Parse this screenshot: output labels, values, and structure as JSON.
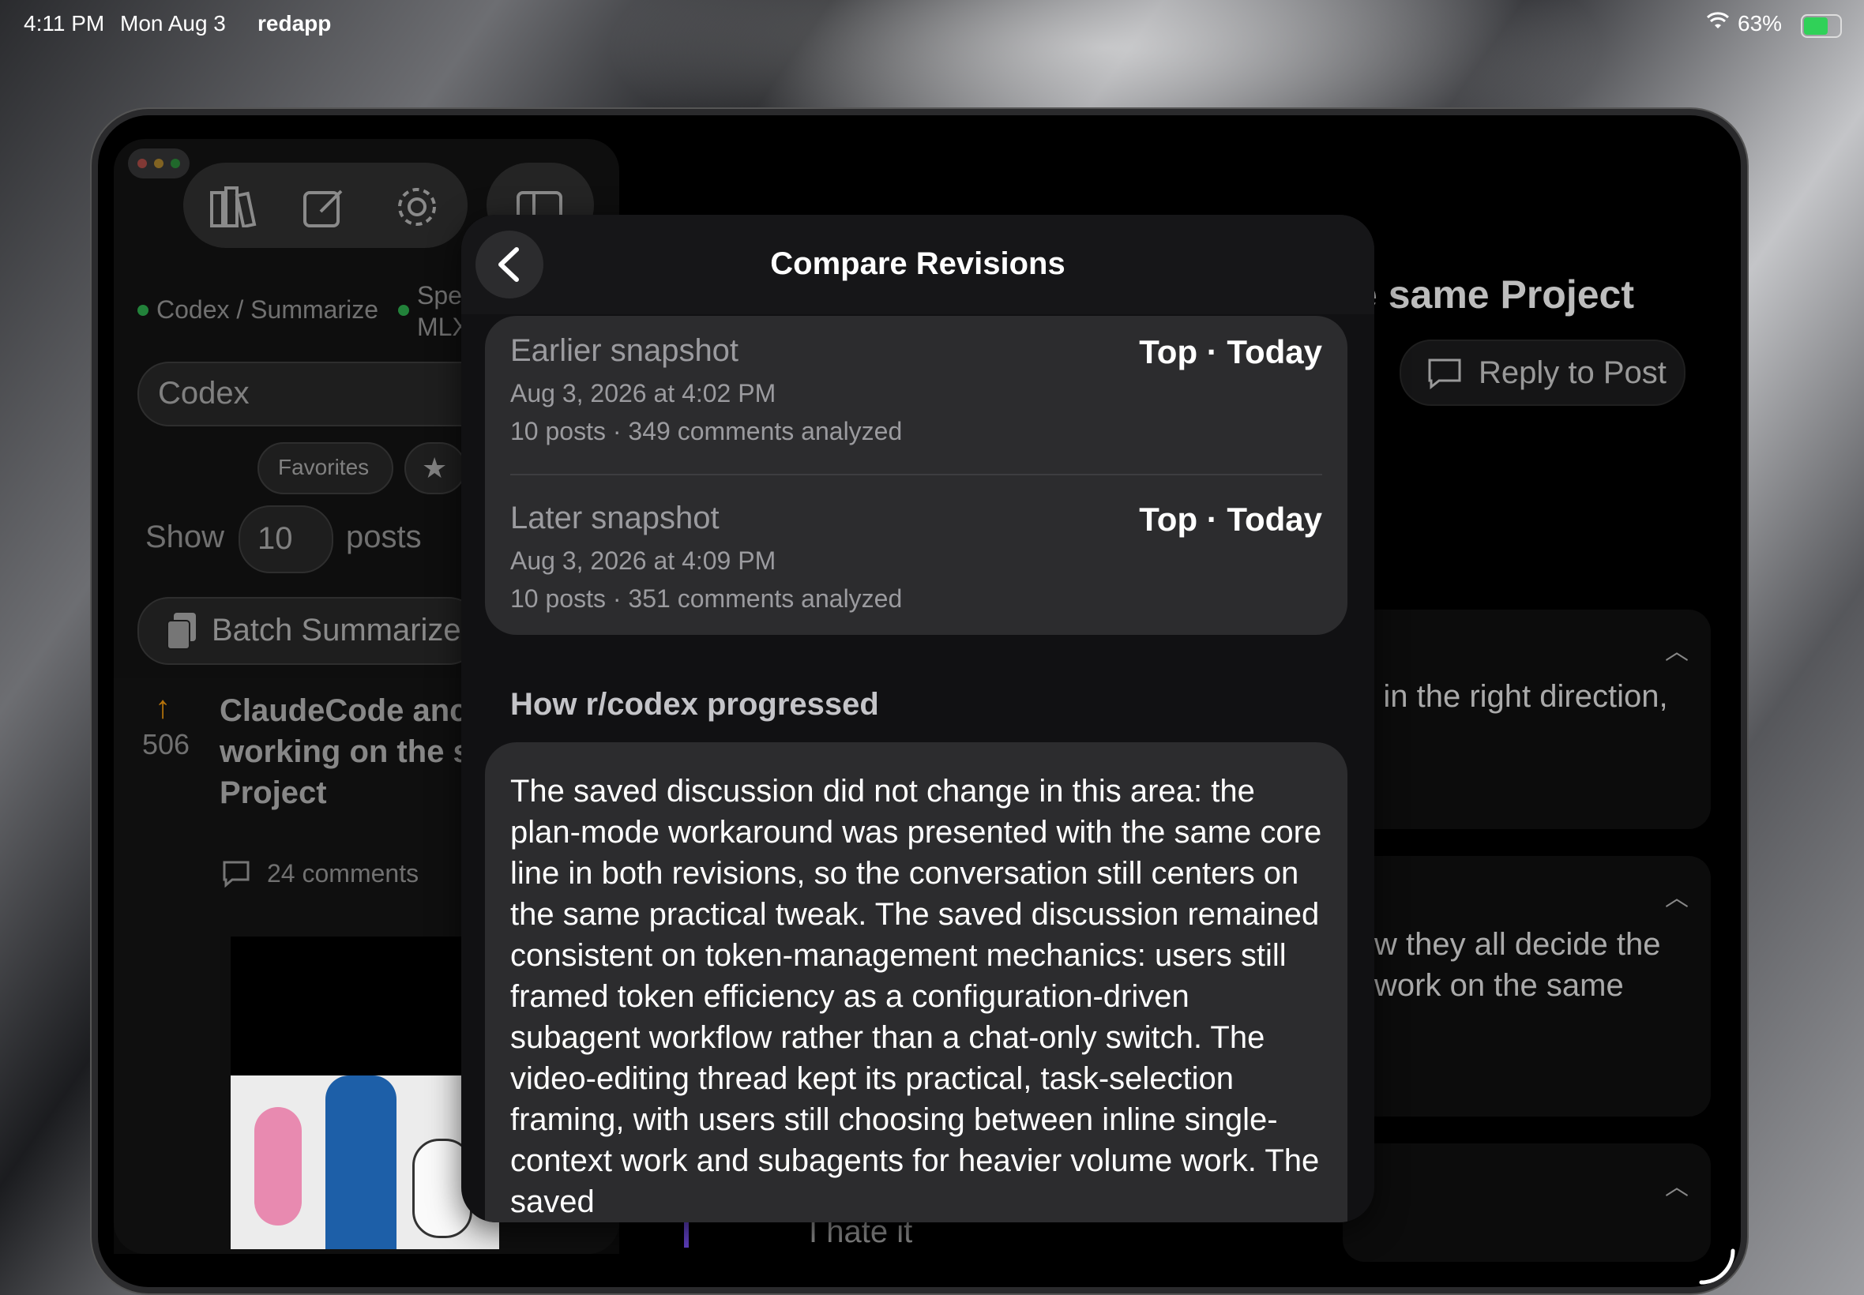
{
  "status_bar": {
    "time": "4:11 PM",
    "date": "Mon Aug 3",
    "app": "redapp",
    "battery": "63%"
  },
  "sidebar": {
    "tags": [
      "Codex / Summarize",
      "Spe",
      "MLX"
    ],
    "search_value": "Codex",
    "favorites_label": "Favorites",
    "show_label": "Show",
    "show_count": "10",
    "posts_label": "posts",
    "batch_label": "Batch Summarize",
    "post": {
      "score": "506",
      "title_lines": [
        "ClaudeCode anc",
        "working on the s",
        "Project"
      ],
      "comments": "24 comments"
    }
  },
  "main": {
    "title_fragment": "e same Project",
    "reply_label": "Reply to Post",
    "comment1_fragment": "g in the right direction,",
    "comment2_line1": "w they all decide the",
    "comment2_line2": "work on the same",
    "comment3_fragment": "I hate it"
  },
  "modal": {
    "title": "Compare Revisions",
    "earlier": {
      "label": "Earlier snapshot",
      "badge": "Top · Today",
      "datetime": "Aug 3, 2026 at 4:02 PM",
      "stats": "10 posts · 349 comments analyzed"
    },
    "later": {
      "label": "Later snapshot",
      "badge": "Top · Today",
      "datetime": "Aug 3, 2026 at 4:09 PM",
      "stats": "10 posts · 351 comments analyzed"
    },
    "section_title": "How r/codex progressed",
    "summary": "The saved discussion did not change in this area: the plan-mode workaround was presented with the same core line in both revisions, so the conversation still centers on the same practical tweak. The saved discussion remained consistent on token-management mechanics: users still framed token efficiency as a configuration-driven subagent workflow rather than a chat-only switch. The video-editing thread kept its practical, task-selection framing, with users still choosing between inline single-context work and subagents for heavier volume work. The saved"
  },
  "colors": {
    "tag_dot": "#30d158",
    "upvote": "#ff9f0a",
    "accent_line": "#5e3fbf"
  }
}
